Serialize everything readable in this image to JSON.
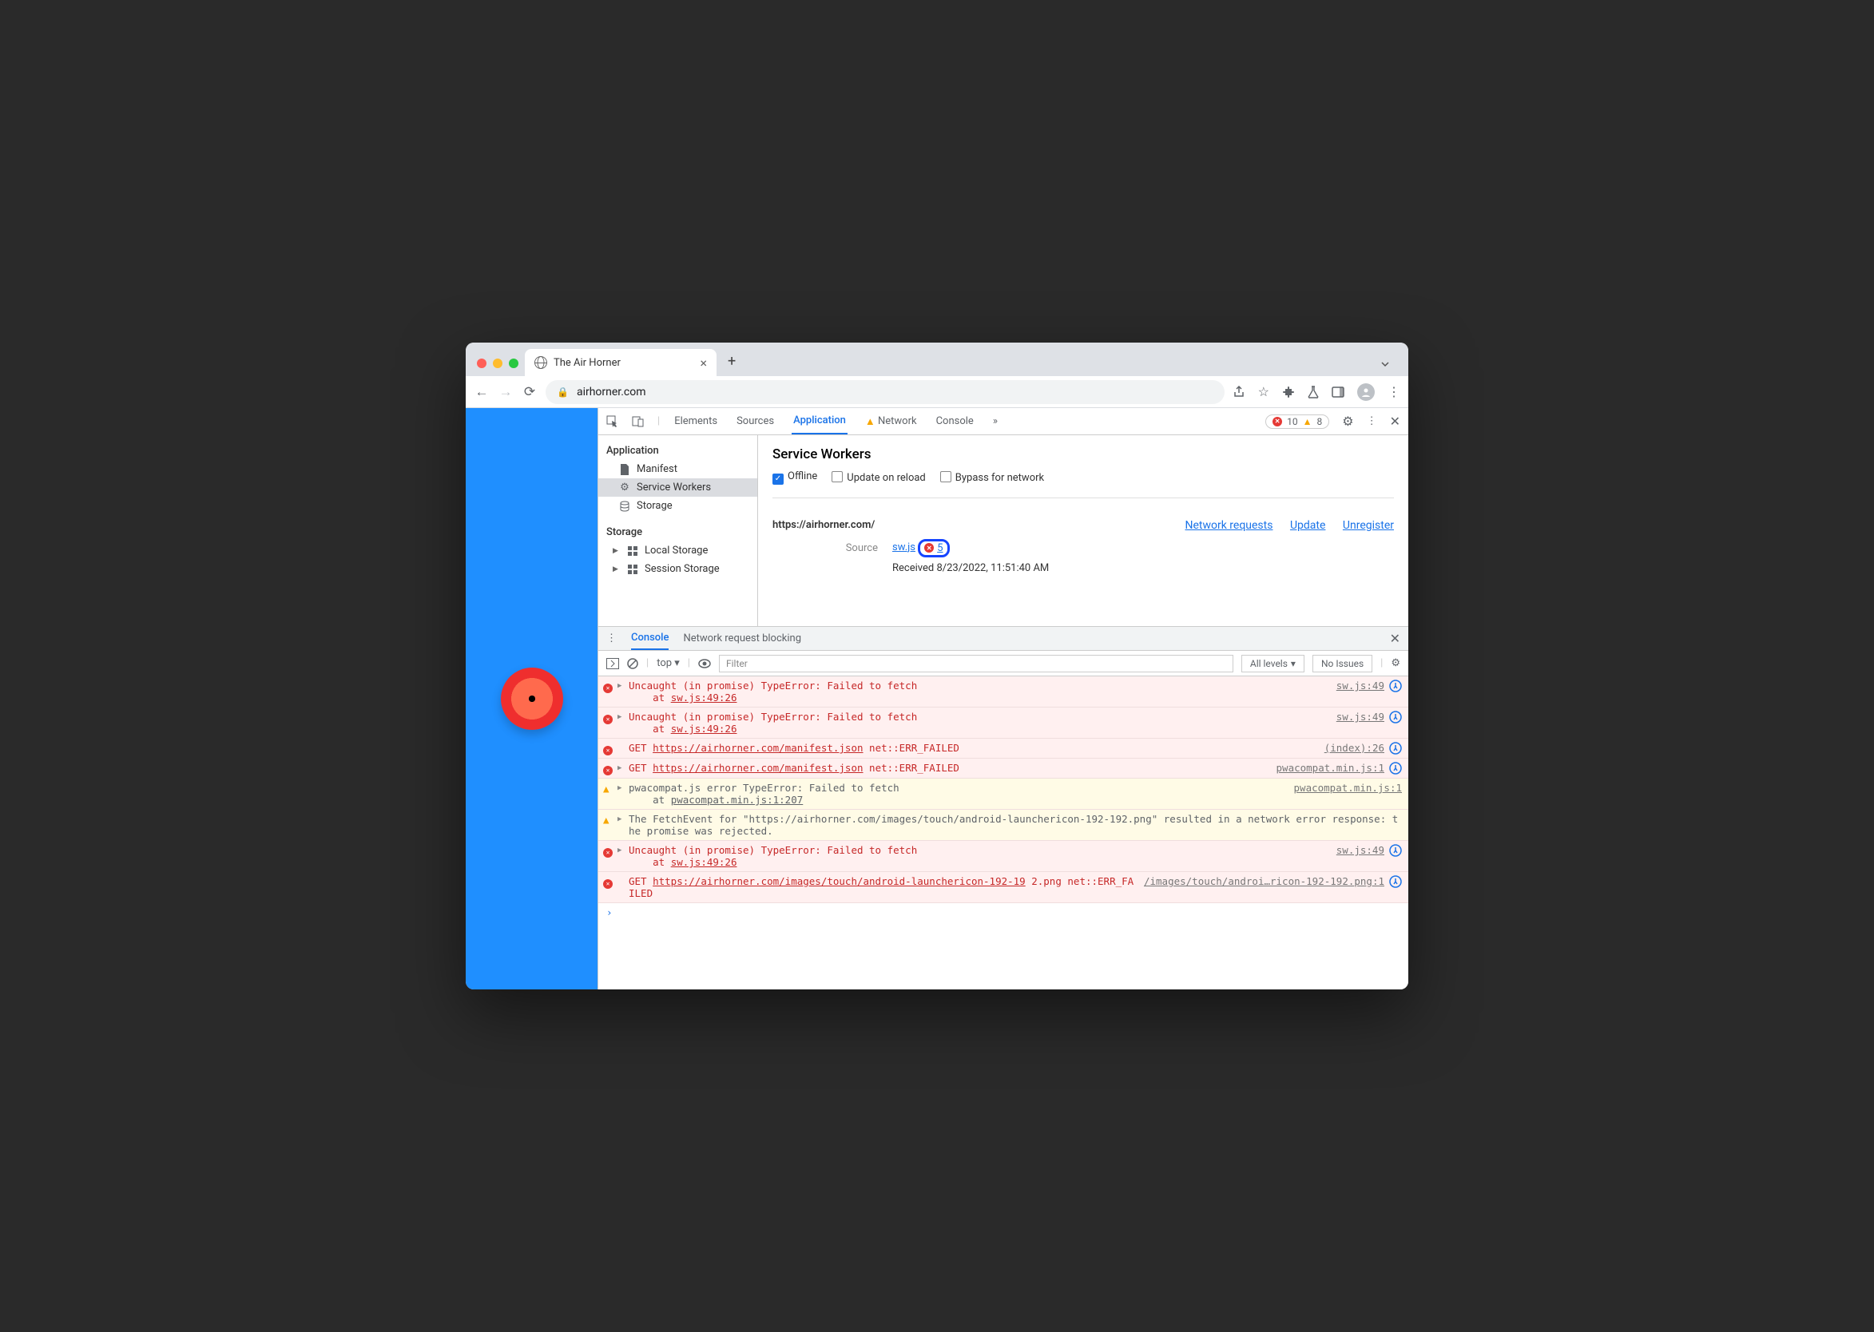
{
  "browser": {
    "tab_title": "The Air Horner",
    "url_display": "airhorner.com"
  },
  "devtools": {
    "tabs": [
      "Elements",
      "Sources",
      "Application",
      "Network",
      "Console"
    ],
    "active_tab": "Application",
    "has_more": "»",
    "error_badge_count": "10",
    "warning_badge_count": "8"
  },
  "app_sidebar": {
    "section1": "Application",
    "items1": [
      "Manifest",
      "Service Workers",
      "Storage"
    ],
    "section2": "Storage",
    "items2": [
      "Local Storage",
      "Session Storage"
    ]
  },
  "sw_panel": {
    "title": "Service Workers",
    "opts": {
      "offline": "Offline",
      "update": "Update on reload",
      "bypass": "Bypass for network"
    },
    "origin": "https://airhorner.com/",
    "links": {
      "net": "Network requests",
      "upd": "Update",
      "unr": "Unregister"
    },
    "source_label": "Source",
    "source_file": "sw.js",
    "source_error_count": "5",
    "received_label": "Received",
    "received_value": "8/23/2022, 11:51:40 AM"
  },
  "drawer": {
    "tabs": [
      "Console",
      "Network request blocking"
    ],
    "toolbar": {
      "context": "top",
      "filter_placeholder": "Filter",
      "levels": "All levels",
      "issues": "No Issues"
    }
  },
  "console": [
    {
      "type": "err",
      "expand": true,
      "body": "Uncaught (in promise) TypeError: Failed to fetch\n    at sw.js:49:26",
      "src": "sw.js:49",
      "reload": true
    },
    {
      "type": "err",
      "expand": true,
      "body": "Uncaught (in promise) TypeError: Failed to fetch\n    at sw.js:49:26",
      "src": "sw.js:49",
      "reload": true
    },
    {
      "type": "err",
      "expand": false,
      "body": "GET https://airhorner.com/manifest.json net::ERR_FAILED",
      "src": "(index):26",
      "reload": true,
      "link_start": 4,
      "link_end": 39
    },
    {
      "type": "err",
      "expand": true,
      "body": "GET https://airhorner.com/manifest.json net::ERR_FAILED",
      "src": "pwacompat.min.js:1",
      "reload": true,
      "link_start": 4,
      "link_end": 39
    },
    {
      "type": "wrn",
      "expand": true,
      "body": "pwacompat.js error TypeError: Failed to fetch\n    at pwacompat.min.js:1:207",
      "src": "pwacompat.min.js:1",
      "reload": false
    },
    {
      "type": "wrn",
      "expand": true,
      "body": "The FetchEvent for \"https://airhorner.com/images/touch/android-launchericon-192-192.png\" resulted in a network error response: the promise was rejected.",
      "src": "",
      "reload": false
    },
    {
      "type": "err",
      "expand": true,
      "body": "Uncaught (in promise) TypeError: Failed to fetch\n    at sw.js:49:26",
      "src": "sw.js:49",
      "reload": true
    },
    {
      "type": "err",
      "expand": false,
      "body": "GET https://airhorner.com/images/touch/android-launchericon-192-192.png net::ERR_FAILED",
      "src": "/images/touch/androi…ricon-192-192.png:1",
      "reload": true,
      "link_start": 4,
      "link_end": 66
    }
  ]
}
